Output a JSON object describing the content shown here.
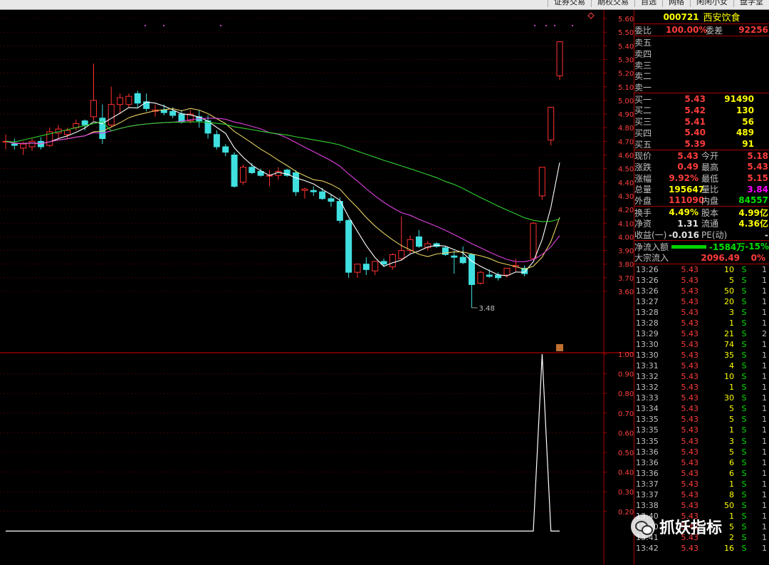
{
  "menu": [
    "证券交易",
    "期权交易",
    "自选",
    "网络",
    "闲闲小女",
    "盘学堂"
  ],
  "stock": {
    "code": "000721",
    "name": "西安饮食"
  },
  "weibi": {
    "label1": "委比",
    "value1": "100.00%",
    "label2": "委差",
    "value2": "92256"
  },
  "sell": [
    {
      "label": "卖五",
      "price": "",
      "vol": ""
    },
    {
      "label": "卖四",
      "price": "",
      "vol": ""
    },
    {
      "label": "卖三",
      "price": "",
      "vol": ""
    },
    {
      "label": "卖二",
      "price": "",
      "vol": ""
    },
    {
      "label": "卖一",
      "price": "",
      "vol": ""
    }
  ],
  "buy": [
    {
      "label": "买一",
      "price": "5.43",
      "vol": "91490"
    },
    {
      "label": "买二",
      "price": "5.42",
      "vol": "130"
    },
    {
      "label": "买三",
      "price": "5.41",
      "vol": "56"
    },
    {
      "label": "买四",
      "price": "5.40",
      "vol": "489"
    },
    {
      "label": "买五",
      "price": "5.39",
      "vol": "91"
    }
  ],
  "quote": [
    {
      "l1": "现价",
      "v1": "5.43",
      "c1": "red",
      "l2": "今开",
      "v2": "5.18",
      "c2": "red"
    },
    {
      "l1": "涨跌",
      "v1": "0.49",
      "c1": "red",
      "l2": "最高",
      "v2": "5.43",
      "c2": "red"
    },
    {
      "l1": "涨幅",
      "v1": "9.92%",
      "c1": "red",
      "l2": "最低",
      "v2": "5.15",
      "c2": "red"
    },
    {
      "l1": "总量",
      "v1": "195647",
      "c1": "yel",
      "l2": "量比",
      "v2": "3.84",
      "c2": "mag"
    },
    {
      "l1": "外盘",
      "v1": "111090",
      "c1": "red",
      "l2": "内盘",
      "v2": "84557",
      "c2": "grn"
    }
  ],
  "fund": [
    {
      "l1": "换手",
      "v1": "4.49%",
      "c1": "yel",
      "l2": "股本",
      "v2": "4.99亿",
      "c2": "yel"
    },
    {
      "l1": "净资",
      "v1": "1.31",
      "c1": "wht",
      "l2": "流通",
      "v2": "4.36亿",
      "c2": "yel"
    },
    {
      "l1": "收益(一)",
      "v1": "-0.016",
      "c1": "wht",
      "l2": "PE(动)",
      "v2": "-",
      "c2": "wht"
    }
  ],
  "flow": {
    "net_label": "净流入额",
    "net_value": "-1584万",
    "net_pct": "-15%",
    "big_label": "大宗流入",
    "big_value": "2096.49",
    "big_pct": "0%"
  },
  "ticks": [
    [
      "13:26",
      "5.43",
      "10",
      "S",
      "1"
    ],
    [
      "13:26",
      "5.43",
      "5",
      "S",
      "1"
    ],
    [
      "13:26",
      "5.43",
      "50",
      "S",
      "1"
    ],
    [
      "13:27",
      "5.43",
      "20",
      "S",
      "1"
    ],
    [
      "13:28",
      "5.43",
      "3",
      "S",
      "1"
    ],
    [
      "13:28",
      "5.43",
      "1",
      "S",
      "1"
    ],
    [
      "13:29",
      "5.43",
      "21",
      "S",
      "2"
    ],
    [
      "13:30",
      "5.43",
      "74",
      "S",
      "1"
    ],
    [
      "13:30",
      "5.43",
      "35",
      "S",
      "1"
    ],
    [
      "13:31",
      "5.43",
      "4",
      "S",
      "1"
    ],
    [
      "13:32",
      "5.43",
      "10",
      "S",
      "1"
    ],
    [
      "13:32",
      "5.43",
      "1",
      "S",
      "1"
    ],
    [
      "13:33",
      "5.43",
      "30",
      "S",
      "1"
    ],
    [
      "13:34",
      "5.43",
      "5",
      "S",
      "1"
    ],
    [
      "13:35",
      "5.43",
      "5",
      "S",
      "1"
    ],
    [
      "13:35",
      "5.43",
      "1",
      "S",
      "1"
    ],
    [
      "13:35",
      "5.43",
      "3",
      "S",
      "1"
    ],
    [
      "13:36",
      "5.43",
      "5",
      "S",
      "1"
    ],
    [
      "13:36",
      "5.43",
      "6",
      "S",
      "1"
    ],
    [
      "13:36",
      "5.43",
      "6",
      "S",
      "1"
    ],
    [
      "13:37",
      "5.43",
      "1",
      "S",
      "1"
    ],
    [
      "13:37",
      "5.43",
      "8",
      "S",
      "1"
    ],
    [
      "13:38",
      "5.43",
      "50",
      "S",
      "1"
    ],
    [
      "13:40",
      "5.43",
      "1",
      "S",
      "1"
    ],
    [
      "13:40",
      "5.43",
      "5",
      "S",
      "1"
    ],
    [
      "13:41",
      "5.43",
      "2",
      "S",
      "1"
    ],
    [
      "13:42",
      "5.43",
      "16",
      "S",
      "1"
    ]
  ],
  "watermark": "抓妖指标",
  "low_label": "3.48",
  "colors": {
    "up": "#ff3030",
    "down": "#40e0e0",
    "grid": "#aa0000",
    "ma5": "#ffffff",
    "ma10": "#e6d060",
    "ma20": "#e040e0",
    "ma60": "#30d030"
  },
  "chart_data": {
    "type": "candlestick",
    "price_axis": {
      "min": 3.55,
      "max": 5.65,
      "ticks": [
        "5.60",
        "5.50",
        "5.40",
        "5.30",
        "5.20",
        "5.10",
        "5.00",
        "4.90",
        "4.80",
        "4.70",
        "4.60",
        "4.50",
        "4.40",
        "4.30",
        "4.20",
        "4.10",
        "4.00",
        "3.90",
        "3.80",
        "3.70",
        "3.60"
      ]
    },
    "indicator_axis": {
      "min": 0.1,
      "max": 1.05,
      "ticks": [
        "1.00",
        "0.90",
        "0.80",
        "0.70",
        "0.60",
        "0.50",
        "0.40",
        "0.30",
        "0.20"
      ]
    },
    "candles": [
      [
        4.7,
        4.75,
        4.64,
        4.7
      ],
      [
        4.68,
        4.72,
        4.64,
        4.67
      ],
      [
        4.65,
        4.7,
        4.6,
        4.68
      ],
      [
        4.66,
        4.72,
        4.63,
        4.7
      ],
      [
        4.7,
        4.73,
        4.64,
        4.66
      ],
      [
        4.67,
        4.8,
        4.66,
        4.77
      ],
      [
        4.76,
        4.82,
        4.72,
        4.79
      ],
      [
        4.75,
        4.8,
        4.72,
        4.78
      ],
      [
        4.8,
        4.86,
        4.78,
        4.83
      ],
      [
        4.85,
        4.86,
        4.78,
        4.82
      ],
      [
        4.88,
        5.27,
        4.85,
        5.0
      ],
      [
        4.87,
        4.97,
        4.68,
        4.72
      ],
      [
        4.82,
        5.1,
        4.8,
        4.97
      ],
      [
        4.97,
        5.05,
        4.9,
        5.02
      ],
      [
        4.97,
        5.05,
        4.95,
        5.03
      ],
      [
        5.05,
        5.07,
        4.95,
        4.98
      ],
      [
        4.99,
        5.05,
        4.92,
        4.94
      ],
      [
        4.92,
        4.97,
        4.88,
        4.93
      ],
      [
        4.93,
        4.97,
        4.89,
        4.91
      ],
      [
        4.92,
        4.95,
        4.87,
        4.89
      ],
      [
        4.9,
        4.93,
        4.83,
        4.84
      ],
      [
        4.85,
        4.93,
        4.83,
        4.9
      ],
      [
        4.88,
        4.93,
        4.8,
        4.85
      ],
      [
        4.85,
        4.89,
        4.72,
        4.76
      ],
      [
        4.75,
        4.78,
        4.64,
        4.66
      ],
      [
        4.66,
        4.68,
        4.59,
        4.62
      ],
      [
        4.6,
        4.62,
        4.36,
        4.37
      ],
      [
        4.4,
        4.53,
        4.38,
        4.51
      ],
      [
        4.51,
        4.54,
        4.46,
        4.47
      ],
      [
        4.48,
        4.5,
        4.44,
        4.45
      ],
      [
        4.45,
        4.49,
        4.37,
        4.45
      ],
      [
        4.45,
        4.51,
        4.42,
        4.48
      ],
      [
        4.49,
        4.5,
        4.44,
        4.45
      ],
      [
        4.47,
        4.49,
        4.3,
        4.33
      ],
      [
        4.34,
        4.36,
        4.28,
        4.35
      ],
      [
        4.34,
        4.37,
        4.3,
        4.33
      ],
      [
        4.33,
        4.36,
        4.27,
        4.28
      ],
      [
        4.28,
        4.31,
        4.22,
        4.26
      ],
      [
        4.26,
        4.29,
        4.1,
        4.12
      ],
      [
        4.12,
        4.13,
        3.7,
        3.74
      ],
      [
        3.74,
        3.78,
        3.7,
        3.8
      ],
      [
        3.8,
        3.85,
        3.72,
        3.76
      ],
      [
        3.75,
        3.82,
        3.72,
        3.82
      ],
      [
        3.82,
        3.84,
        3.78,
        3.8
      ],
      [
        3.78,
        3.88,
        3.76,
        3.87
      ],
      [
        3.84,
        4.15,
        3.83,
        3.9
      ],
      [
        3.9,
        4.01,
        3.88,
        3.98
      ],
      [
        4.0,
        4.05,
        3.92,
        3.93
      ],
      [
        3.92,
        3.97,
        3.9,
        3.95
      ],
      [
        3.95,
        3.96,
        3.92,
        3.93
      ],
      [
        3.92,
        3.93,
        3.86,
        3.87
      ],
      [
        3.86,
        3.9,
        3.73,
        3.85
      ],
      [
        3.85,
        3.93,
        3.8,
        3.81
      ],
      [
        3.87,
        3.88,
        3.48,
        3.65
      ],
      [
        3.66,
        3.75,
        3.65,
        3.74
      ],
      [
        3.72,
        3.76,
        3.7,
        3.71
      ],
      [
        3.72,
        3.74,
        3.68,
        3.7
      ],
      [
        3.72,
        3.77,
        3.7,
        3.77
      ],
      [
        3.78,
        3.84,
        3.74,
        3.79
      ],
      [
        3.77,
        3.79,
        3.71,
        3.73
      ],
      [
        3.84,
        4.11,
        3.84,
        4.1
      ],
      [
        4.3,
        4.51,
        4.27,
        4.51
      ],
      [
        4.71,
        4.95,
        4.67,
        4.95
      ],
      [
        5.18,
        5.43,
        5.15,
        5.43
      ]
    ]
  }
}
